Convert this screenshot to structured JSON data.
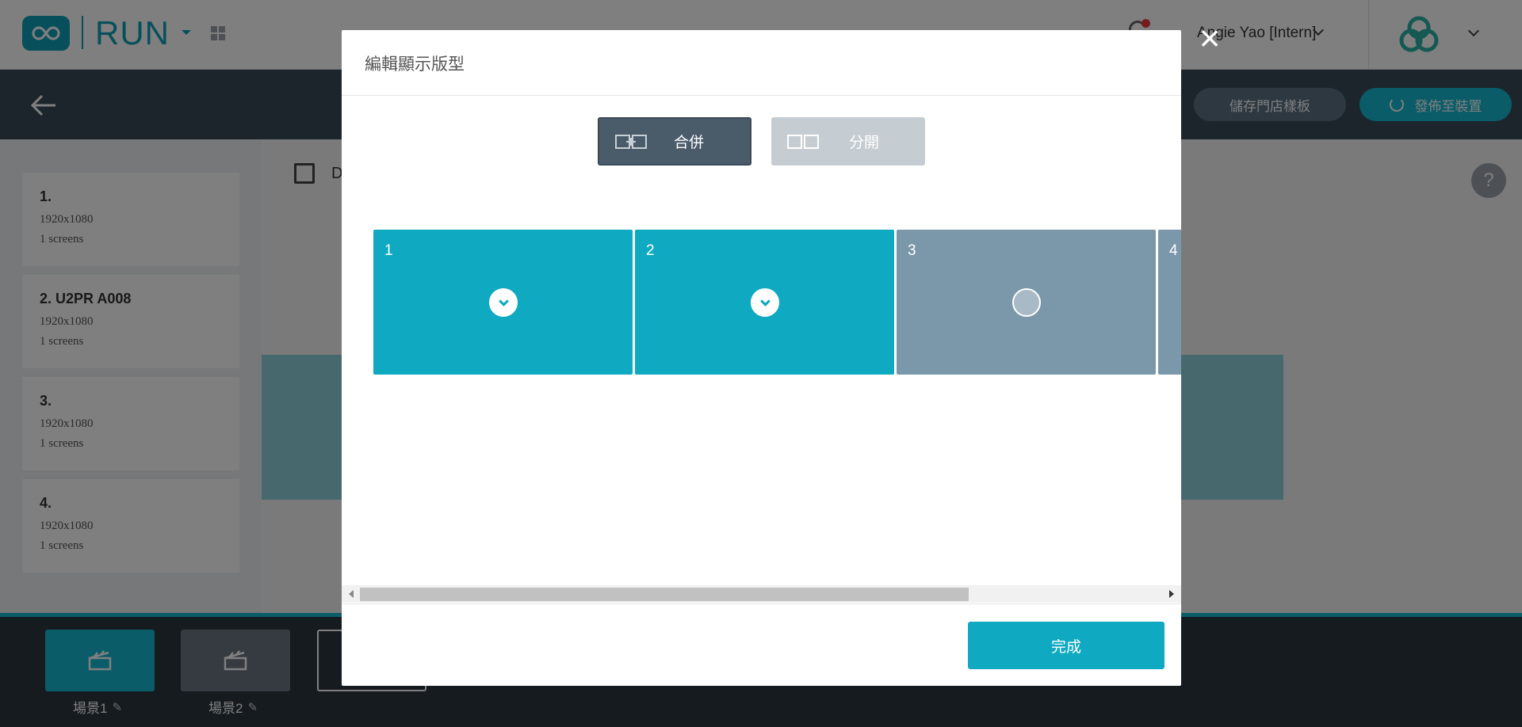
{
  "app": {
    "brand_name": "RUN",
    "user_name": "Angie Yao [Intern]"
  },
  "toolbar": {
    "save_template_label": "儲存門店樣板",
    "publish_label": "發佈至裝置"
  },
  "sidebar": {
    "screens": [
      {
        "title": "1.",
        "resolution": "1920x1080",
        "count": "1 screens"
      },
      {
        "title": "2. U2PR A008",
        "resolution": "1920x1080",
        "count": "1 screens"
      },
      {
        "title": "3.",
        "resolution": "1920x1080",
        "count": "1 screens"
      },
      {
        "title": "4.",
        "resolution": "1920x1080",
        "count": "1 screens"
      }
    ]
  },
  "main": {
    "store_label": "D",
    "help_label": "?"
  },
  "scenes": [
    {
      "label": "場景1",
      "active": true
    },
    {
      "label": "場景2",
      "active": false
    }
  ],
  "modal": {
    "title": "編輯顯示版型",
    "merge_label": "合併",
    "split_label": "分開",
    "merge_selected": true,
    "cells": [
      {
        "number": "1",
        "state": "merged-checked"
      },
      {
        "number": "2",
        "state": "merged-checked"
      },
      {
        "number": "3",
        "state": "unchecked"
      },
      {
        "number": "4",
        "state": "unchecked"
      }
    ],
    "done_label": "完成",
    "close_label": "×"
  },
  "colors": {
    "accent": "#0fa9c1",
    "merged_cell": "#0fa9c1",
    "unselected_cell": "#7b98aa",
    "merge_button": "#4a5b6a",
    "split_button": "#c6cdd2",
    "header_dark": "#3a4a59"
  }
}
